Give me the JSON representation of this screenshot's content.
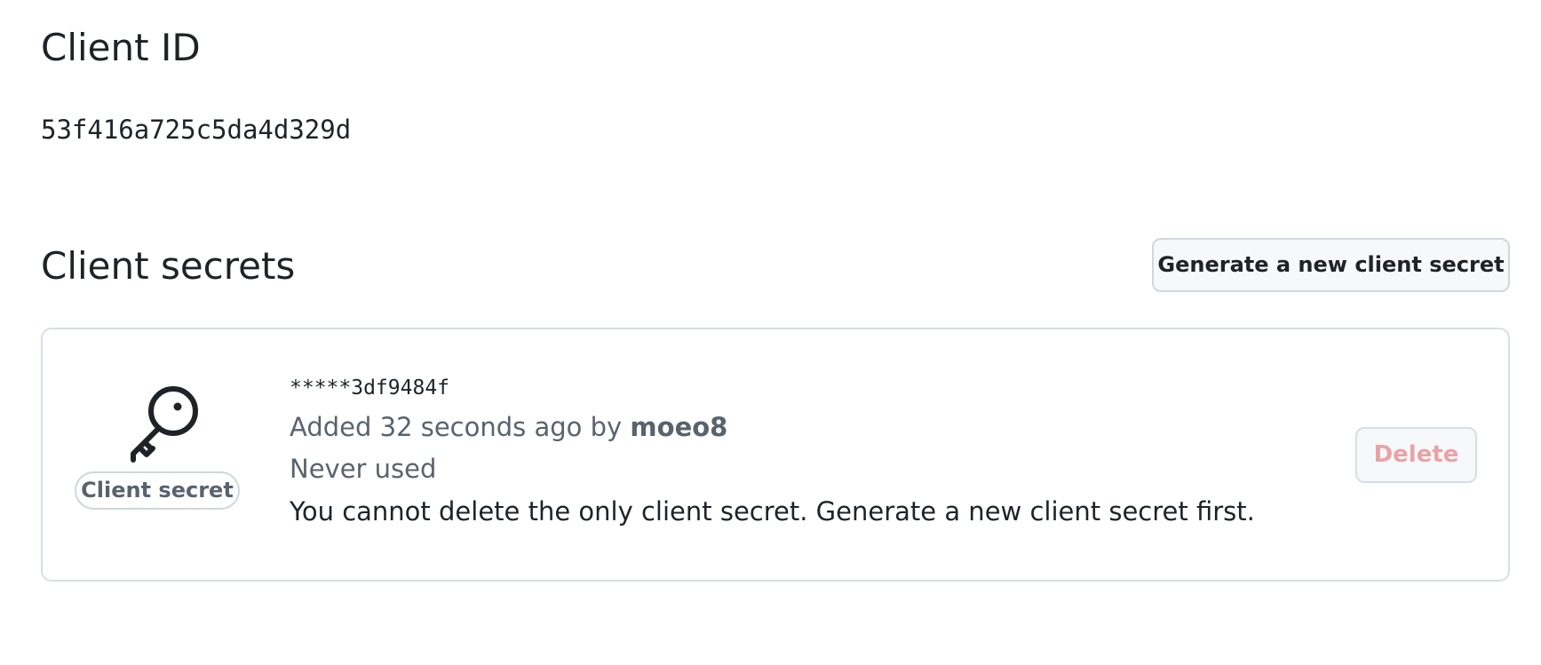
{
  "client_id": {
    "heading": "Client ID",
    "value": "53f416a725c5da4d329d"
  },
  "client_secrets": {
    "heading": "Client secrets",
    "generate_button_label": "Generate a new client secret",
    "items": [
      {
        "icon": "key-icon",
        "label": "Client secret",
        "masked_value": "*****3df9484f",
        "added_prefix": "Added 32 seconds ago by ",
        "added_by": "moeo8",
        "usage": "Never used",
        "note": "You cannot delete the only client secret. Generate a new client secret first.",
        "delete_label": "Delete"
      }
    ]
  },
  "colors": {
    "text_primary": "#1f2328",
    "text_muted": "#59636e",
    "border": "#d0d7de",
    "button_bg": "#f6f8fa",
    "danger_disabled": "#e8a3a8"
  }
}
